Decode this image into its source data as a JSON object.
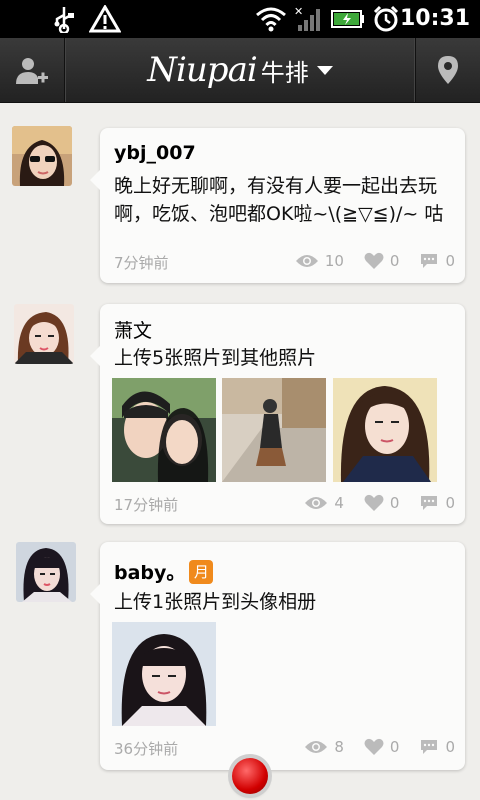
{
  "statusbar": {
    "time": "10:31"
  },
  "appbar": {
    "logo_text": "Niupai",
    "city": "牛排"
  },
  "feed": [
    {
      "user": "ybj_007",
      "content": "晚上好无聊啊，有没有人要一起出去玩啊，吃饭、泡吧都OK啦~\\(≧▽≦)/~ 咕",
      "time": "7分钟前",
      "views": "10",
      "likes": "0",
      "comments": "0"
    },
    {
      "user": "萧文",
      "content": "上传5张照片到其他照片",
      "time": "17分钟前",
      "views": "4",
      "likes": "0",
      "comments": "0"
    },
    {
      "user": "baby。",
      "badge": "月",
      "content": "上传1张照片到头像相册",
      "time": "36分钟前",
      "views": "8",
      "likes": "0",
      "comments": "0"
    }
  ],
  "colors": {
    "accent": "#f08a1c",
    "background": "#efeeeb",
    "record": "#d10000"
  }
}
